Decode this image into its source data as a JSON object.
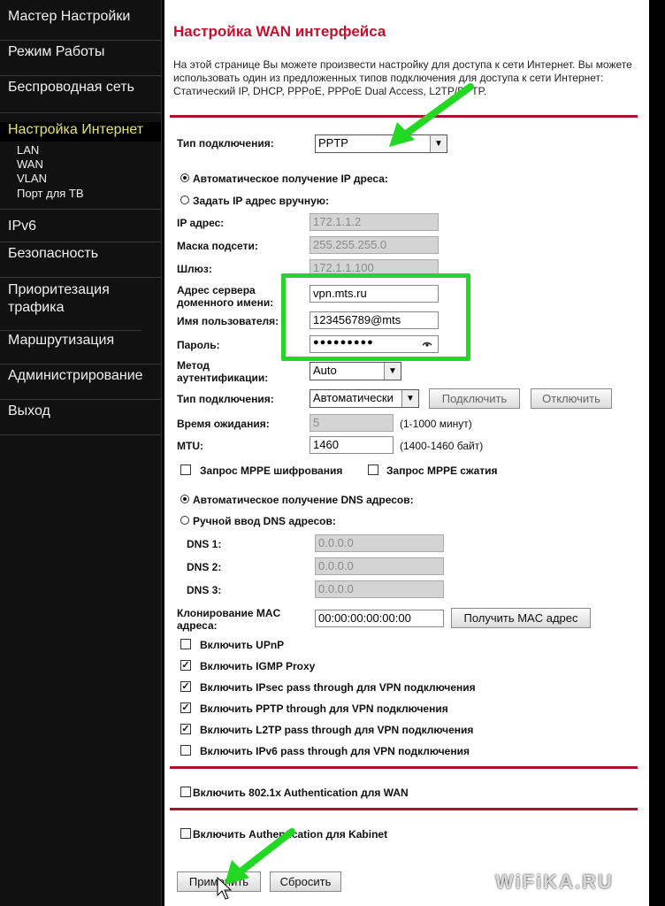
{
  "sidebar": {
    "items": [
      {
        "label": "Мастер Настройки"
      },
      {
        "label": "Режим Работы"
      },
      {
        "label": "Беспроводная сеть"
      },
      {
        "label": "Настройка Интернет",
        "active": true
      },
      {
        "label": "IPv6"
      },
      {
        "label": "Безопасность"
      },
      {
        "label": "Приоритезация трафика"
      },
      {
        "label": "Маршрутизация"
      },
      {
        "label": "Администрирование"
      },
      {
        "label": "Выход"
      }
    ],
    "sub_items": [
      "LAN",
      "WAN",
      "VLAN",
      "Порт для ТВ"
    ]
  },
  "page": {
    "title": "Настройка WAN интерфейса",
    "intro": "На этой странице Вы можете произвести настройку для доступа к сети Интернет. Вы можете использовать один из предложенных типов подключения для доступа к сети Интернет: Статический IP, DHCP, PPPoE, PPPoE Dual Access, L2TP/PPTP."
  },
  "connection": {
    "label": "Тип подключения:",
    "value": "PPTP"
  },
  "ip": {
    "auto_label": "Автоматическое получение IP дреса:",
    "manual_label": "Задать IP адрес вручную:",
    "ip_label": "IP адрес:",
    "ip_value": "172.1.1.2",
    "mask_label": "Маска подсети:",
    "mask_value": "255.255.255.0",
    "gw_label": "Шлюз:",
    "gw_value": "172.1.1.100"
  },
  "server": {
    "server_label_1": "Адрес сервера",
    "server_label_2": "доменного имени:",
    "server_value": "vpn.mts.ru",
    "user_label": "Имя пользователя:",
    "user_value": "123456789@mts",
    "pass_label": "Пароль:",
    "pass_value": "●●●●●●●●●",
    "pass_eye": "eye-icon"
  },
  "auth": {
    "method_label_1": "Метод",
    "method_label_2": "аутентификации:",
    "method_value": "Auto",
    "conn_type_label": "Тип подключения:",
    "conn_type_value": "Автоматически",
    "connect_button": "Подключить",
    "disconnect_button": "Отключить",
    "timeout_label": "Время ожидания:",
    "timeout_value": "5",
    "timeout_hint": "(1-1000 минут)",
    "mtu_label": "MTU:",
    "mtu_value": "1460",
    "mtu_hint": "(1400-1460 байт)",
    "mppe_encrypt": "Запрос MPPE шифрования",
    "mppe_compress": "Запрос MPPE сжатия"
  },
  "dns": {
    "auto_label": "Автоматическое получение DNS адресов:",
    "manual_label": "Ручной ввод DNS адресов:",
    "dns1_label": "DNS 1:",
    "dns1_value": "0.0.0.0",
    "dns2_label": "DNS 2:",
    "dns2_value": "0.0.0.0",
    "dns3_label": "DNS 3:",
    "dns3_value": "0.0.0.0"
  },
  "mac": {
    "label_1": "Клонирование MAC",
    "label_2": "адреса:",
    "value": "00:00:00:00:00:00",
    "button": "Получить MAC адрес"
  },
  "options": [
    {
      "label": "Включить UPnP",
      "checked": false
    },
    {
      "label": "Включить IGMP Proxy",
      "checked": true
    },
    {
      "label": "Включить IPsec pass through для VPN подключения",
      "checked": true
    },
    {
      "label": "Включить PPTP through для VPN подключения",
      "checked": true
    },
    {
      "label": "Включить L2TP pass through для VPN подключения",
      "checked": true
    },
    {
      "label": "Включить IPv6 pass through для VPN подключения",
      "checked": false
    }
  ],
  "auth8021x": {
    "label": "Включить 802.1x Authentication для WAN"
  },
  "kabinet": {
    "label": "Включить Authentication для Kabinet"
  },
  "actions": {
    "apply": "Применить",
    "reset": "Сбросить"
  },
  "watermark": "WiFiKA.RU",
  "colors": {
    "title": "#c8102e",
    "separator": "#b01030",
    "highlight": "#22d822",
    "arrow": "#22d822",
    "active_nav": "#e6e36a"
  }
}
